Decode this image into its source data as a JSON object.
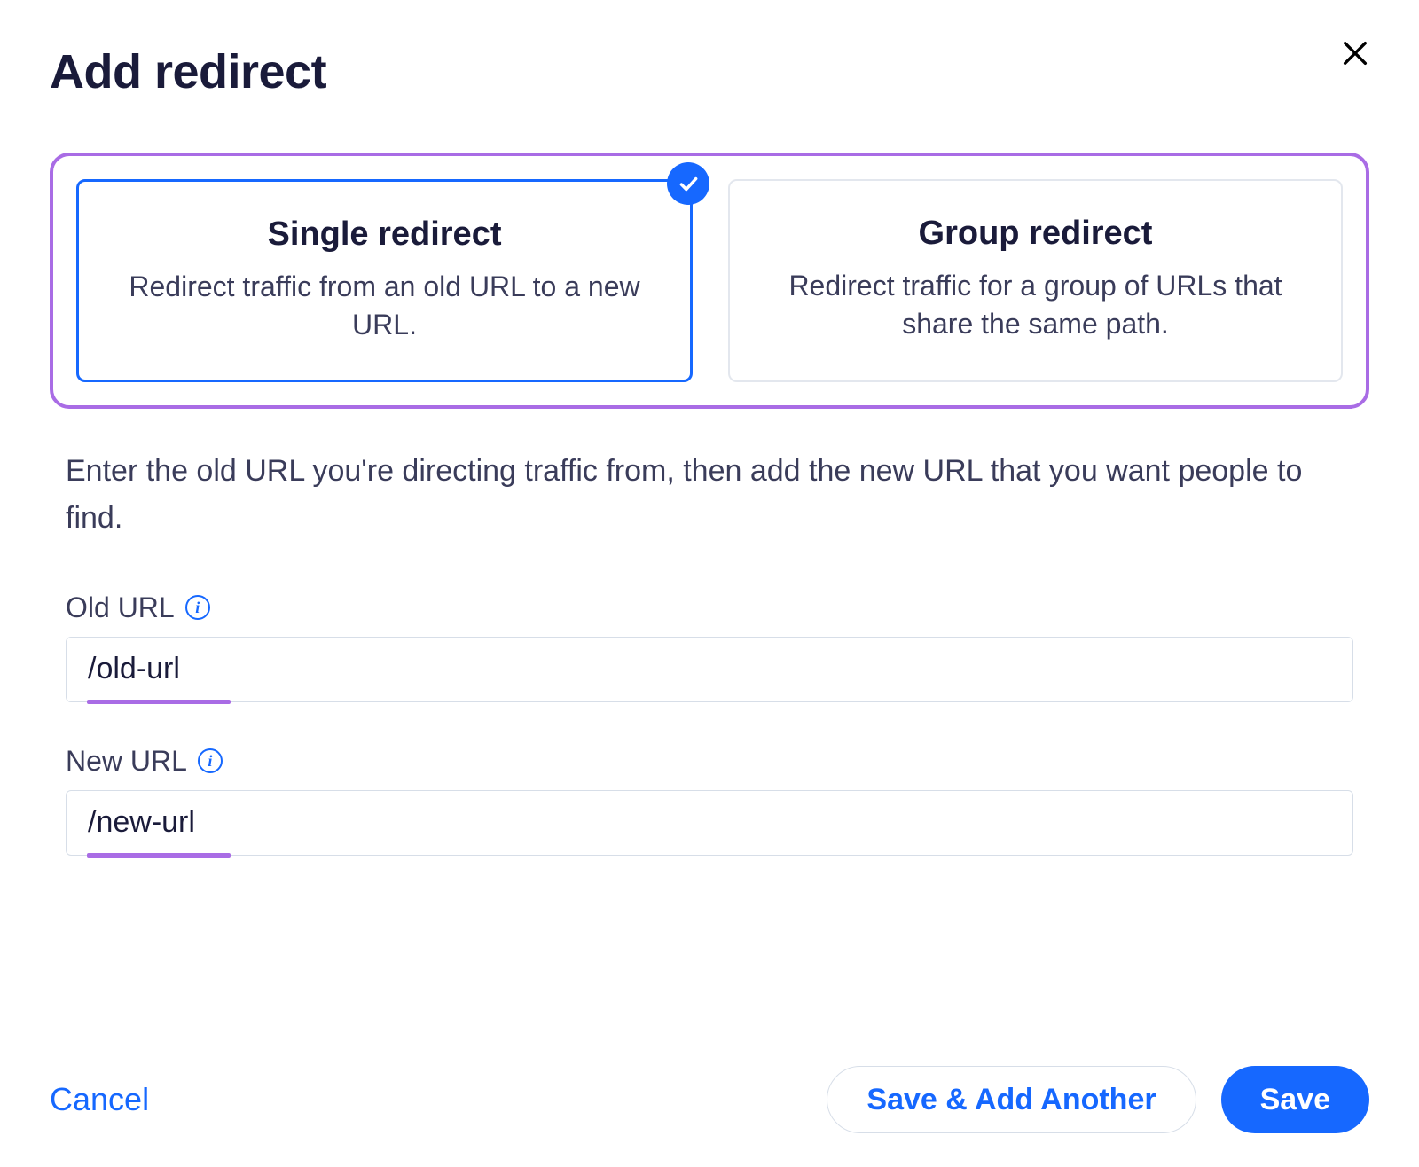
{
  "modal": {
    "title": "Add redirect",
    "redirect_type": {
      "single": {
        "title": "Single redirect",
        "description": "Redirect traffic from an old URL to a new URL."
      },
      "group": {
        "title": "Group redirect",
        "description": "Redirect traffic for a group of URLs that share the same path."
      }
    },
    "instructions": "Enter the old URL you're directing traffic from, then add the new URL that you want people to find.",
    "fields": {
      "old_url": {
        "label": "Old URL",
        "value": "/old-url"
      },
      "new_url": {
        "label": "New URL",
        "value": "/new-url"
      }
    },
    "actions": {
      "cancel": "Cancel",
      "save_add": "Save & Add Another",
      "save": "Save"
    }
  }
}
